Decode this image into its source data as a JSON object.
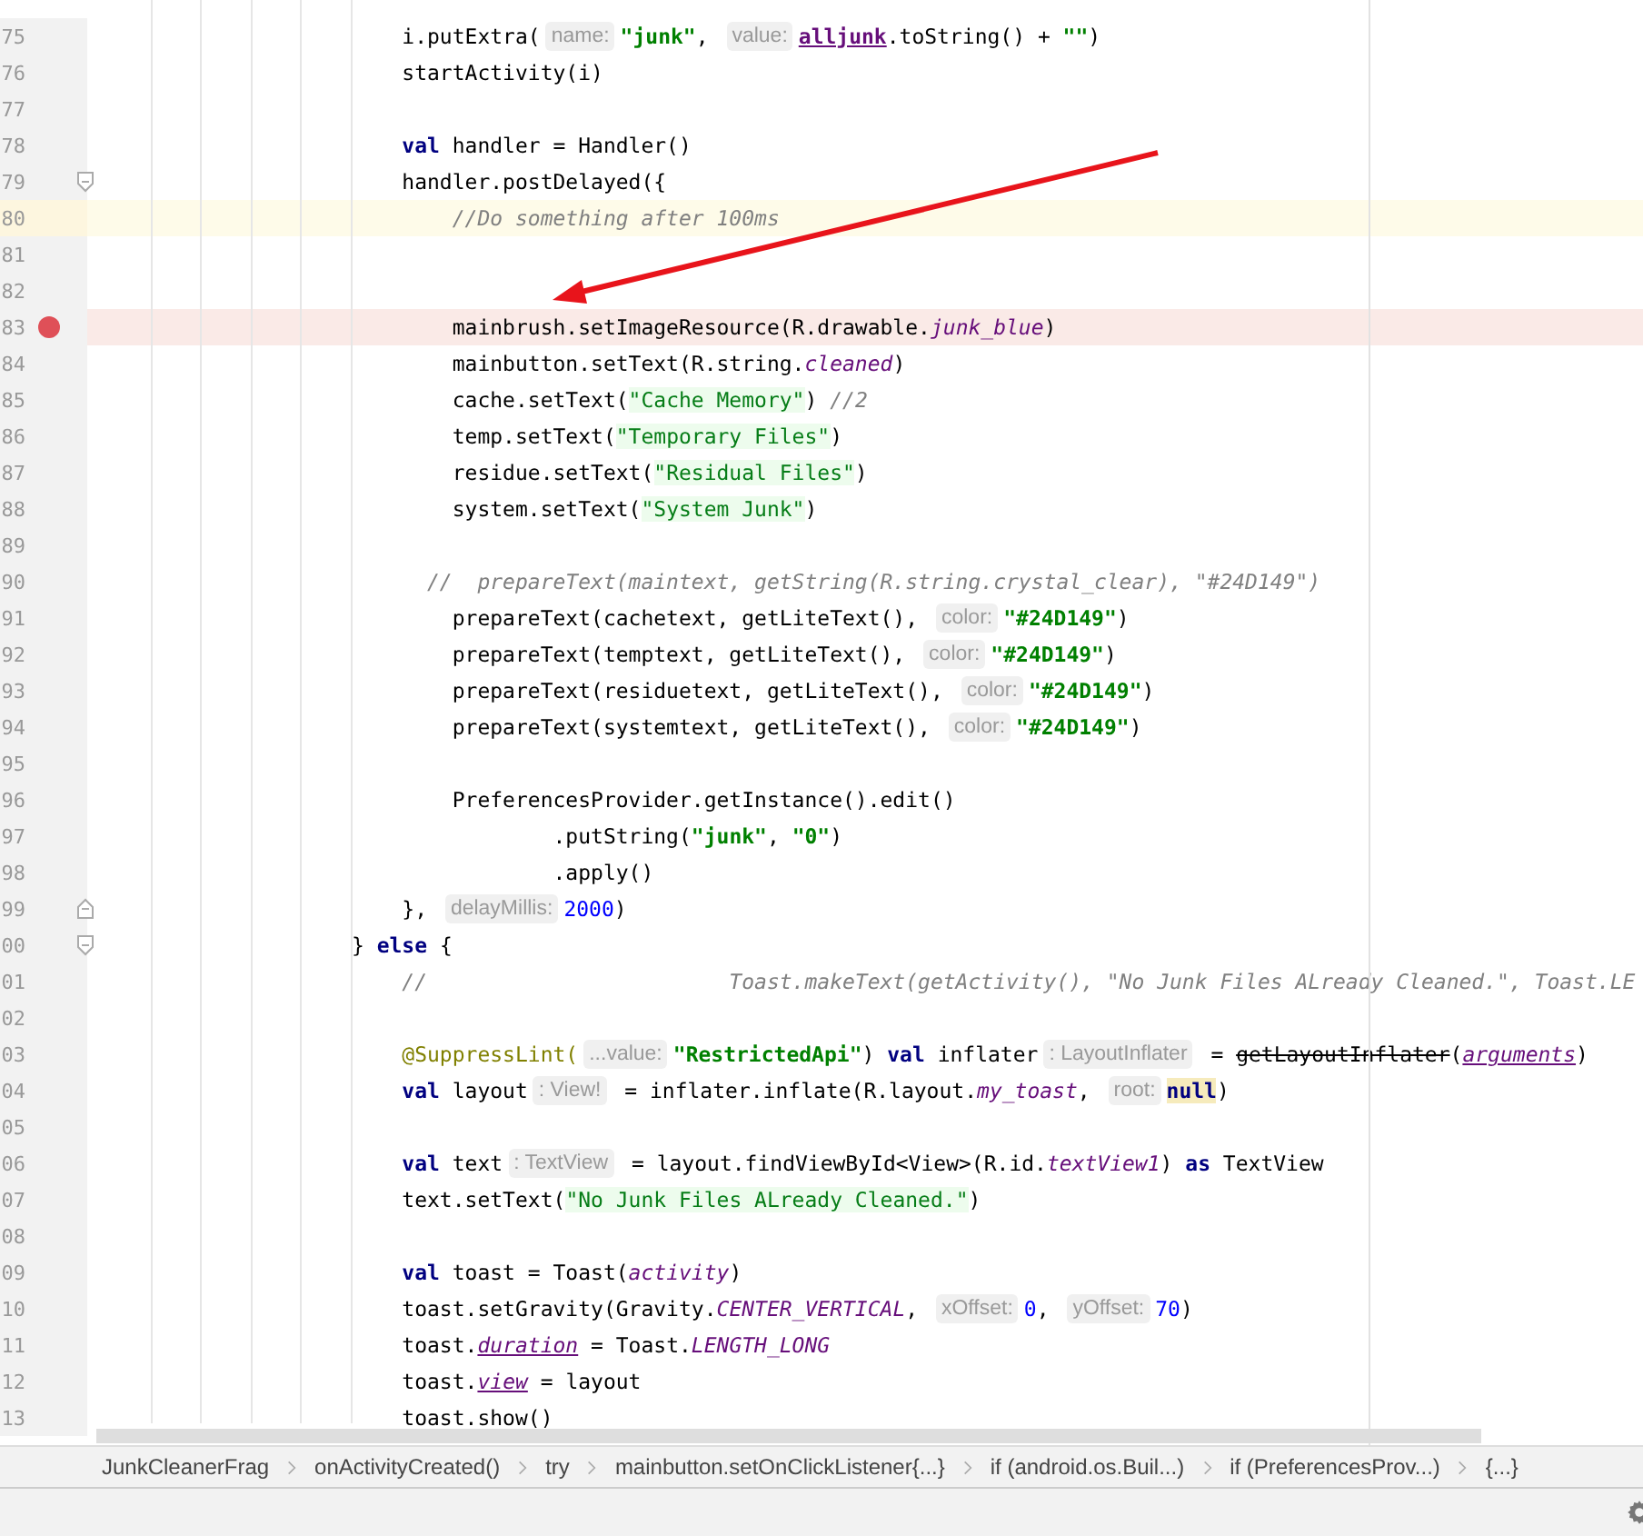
{
  "editor": {
    "lines": [
      {
        "number": "75",
        "breakpoint": false,
        "current": false,
        "tokens": [
          {
            "kind": "plain",
            "text": "                        i.putExtra("
          },
          {
            "kind": "hint",
            "text": "name:"
          },
          {
            "kind": "string",
            "text": "\"junk\""
          },
          {
            "kind": "plain",
            "text": ", "
          },
          {
            "kind": "hint",
            "text": "value:"
          },
          {
            "kind": "variable",
            "text": "alljunk"
          },
          {
            "kind": "plain",
            "text": ".toString() + "
          },
          {
            "kind": "string",
            "text": "\"\""
          },
          {
            "kind": "plain",
            "text": ")"
          }
        ]
      },
      {
        "number": "76",
        "breakpoint": false,
        "current": false,
        "tokens": [
          {
            "kind": "plain",
            "text": "                        startActivity(i)"
          }
        ]
      },
      {
        "number": "77",
        "breakpoint": false,
        "current": false
      },
      {
        "number": "78",
        "breakpoint": false,
        "current": false,
        "tokens": [
          {
            "kind": "keyword",
            "text": "                        val"
          },
          {
            "kind": "plain",
            "text": " handler = Handler()"
          }
        ]
      },
      {
        "number": "79",
        "breakpoint": false,
        "current": false,
        "fold_start": true,
        "tokens": [
          {
            "kind": "plain",
            "text": "                        handler.postDelayed({"
          }
        ]
      },
      {
        "number": "80",
        "breakpoint": false,
        "current": true,
        "tokens": [
          {
            "kind": "comment",
            "text": "                            //Do something after 100ms"
          }
        ]
      },
      {
        "number": "81",
        "breakpoint": false,
        "current": false
      },
      {
        "number": "82",
        "breakpoint": false,
        "current": false
      },
      {
        "number": "83",
        "breakpoint": true,
        "current": false,
        "tokens": [
          {
            "kind": "plain",
            "text": "                            mainbrush.setImageResource(R.drawable."
          },
          {
            "kind": "constant",
            "text": "junk_blue"
          },
          {
            "kind": "plain",
            "text": ")"
          }
        ]
      },
      {
        "number": "84",
        "breakpoint": false,
        "current": false,
        "tokens": [
          {
            "kind": "plain",
            "text": "                            mainbutton.setText(R.string."
          },
          {
            "kind": "constant",
            "text": "cleaned"
          },
          {
            "kind": "plain",
            "text": ")"
          }
        ]
      },
      {
        "number": "85",
        "breakpoint": false,
        "current": false,
        "tokens": [
          {
            "kind": "plain",
            "text": "                            cache.setText("
          },
          {
            "kind": "injected",
            "text": "\"Cache Memory\""
          },
          {
            "kind": "plain",
            "text": ") "
          },
          {
            "kind": "comment",
            "text": "//2"
          }
        ]
      },
      {
        "number": "86",
        "breakpoint": false,
        "current": false,
        "tokens": [
          {
            "kind": "plain",
            "text": "                            temp.setText("
          },
          {
            "kind": "injected",
            "text": "\"Temporary Files\""
          },
          {
            "kind": "plain",
            "text": ")"
          }
        ]
      },
      {
        "number": "87",
        "breakpoint": false,
        "current": false,
        "tokens": [
          {
            "kind": "plain",
            "text": "                            residue.setText("
          },
          {
            "kind": "injected",
            "text": "\"Residual Files\""
          },
          {
            "kind": "plain",
            "text": ")"
          }
        ]
      },
      {
        "number": "88",
        "breakpoint": false,
        "current": false,
        "tokens": [
          {
            "kind": "plain",
            "text": "                            system.setText("
          },
          {
            "kind": "injected",
            "text": "\"System Junk\""
          },
          {
            "kind": "plain",
            "text": ")"
          }
        ]
      },
      {
        "number": "89",
        "breakpoint": false,
        "current": false
      },
      {
        "number": "90",
        "breakpoint": false,
        "current": false,
        "tokens": [
          {
            "kind": "comment",
            "text": "                          //  prepareText(maintext, getString(R.string.crystal_clear), \"#24D149\")"
          }
        ]
      },
      {
        "number": "91",
        "breakpoint": false,
        "current": false,
        "tokens": [
          {
            "kind": "plain",
            "text": "                            prepareText(cachetext, getLiteText(), "
          },
          {
            "kind": "hint",
            "text": "color:"
          },
          {
            "kind": "string",
            "text": "\"#24D149\""
          },
          {
            "kind": "plain",
            "text": ")"
          }
        ]
      },
      {
        "number": "92",
        "breakpoint": false,
        "current": false,
        "tokens": [
          {
            "kind": "plain",
            "text": "                            prepareText(temptext, getLiteText(), "
          },
          {
            "kind": "hint",
            "text": "color:"
          },
          {
            "kind": "string",
            "text": "\"#24D149\""
          },
          {
            "kind": "plain",
            "text": ")"
          }
        ]
      },
      {
        "number": "93",
        "breakpoint": false,
        "current": false,
        "tokens": [
          {
            "kind": "plain",
            "text": "                            prepareText(residuetext, getLiteText(), "
          },
          {
            "kind": "hint",
            "text": "color:"
          },
          {
            "kind": "string",
            "text": "\"#24D149\""
          },
          {
            "kind": "plain",
            "text": ")"
          }
        ]
      },
      {
        "number": "94",
        "breakpoint": false,
        "current": false,
        "tokens": [
          {
            "kind": "plain",
            "text": "                            prepareText(systemtext, getLiteText(), "
          },
          {
            "kind": "hint",
            "text": "color:"
          },
          {
            "kind": "string",
            "text": "\"#24D149\""
          },
          {
            "kind": "plain",
            "text": ")"
          }
        ]
      },
      {
        "number": "95",
        "breakpoint": false,
        "current": false
      },
      {
        "number": "96",
        "breakpoint": false,
        "current": false,
        "tokens": [
          {
            "kind": "plain",
            "text": "                            PreferencesProvider.getInstance().edit()"
          }
        ]
      },
      {
        "number": "97",
        "breakpoint": false,
        "current": false,
        "tokens": [
          {
            "kind": "plain",
            "text": "                                    .putString("
          },
          {
            "kind": "string",
            "text": "\"junk\""
          },
          {
            "kind": "plain",
            "text": ", "
          },
          {
            "kind": "string",
            "text": "\"0\""
          },
          {
            "kind": "plain",
            "text": ")"
          }
        ]
      },
      {
        "number": "98",
        "breakpoint": false,
        "current": false,
        "tokens": [
          {
            "kind": "plain",
            "text": "                                    .apply()"
          }
        ]
      },
      {
        "number": "99",
        "breakpoint": false,
        "current": false,
        "fold_end": true,
        "tokens": [
          {
            "kind": "plain",
            "text": "                        }, "
          },
          {
            "kind": "hint",
            "text": "delayMillis:"
          },
          {
            "kind": "number",
            "text": "2000"
          },
          {
            "kind": "plain",
            "text": ")"
          }
        ]
      },
      {
        "number": "00",
        "breakpoint": false,
        "current": false,
        "fold_start": true,
        "tokens": [
          {
            "kind": "plain",
            "text": "                    } "
          },
          {
            "kind": "keyword",
            "text": "else"
          },
          {
            "kind": "plain",
            "text": " {"
          }
        ]
      },
      {
        "number": "01",
        "breakpoint": false,
        "current": false,
        "tokens": [
          {
            "kind": "comment",
            "text": "                        //                        Toast.makeText(getActivity(), \"No Junk Files ALready Cleaned.\", Toast.LE"
          }
        ]
      },
      {
        "number": "02",
        "breakpoint": false,
        "current": false
      },
      {
        "number": "03",
        "breakpoint": false,
        "current": false,
        "tokens": [
          {
            "kind": "annotation",
            "text": "                        @SuppressLint("
          },
          {
            "kind": "hint",
            "text": "...value:"
          },
          {
            "kind": "string",
            "text": "\"RestrictedApi\""
          },
          {
            "kind": "plain",
            "text": ") "
          },
          {
            "kind": "keyword",
            "text": "val"
          },
          {
            "kind": "plain",
            "text": " inflater"
          },
          {
            "kind": "hint",
            "text": ": LayoutInflater"
          },
          {
            "kind": "plain",
            "text": " = "
          },
          {
            "kind": "deprecated",
            "text": "getLayoutInflater"
          },
          {
            "kind": "plain",
            "text": "("
          },
          {
            "kind": "property",
            "text": "arguments"
          },
          {
            "kind": "plain",
            "text": ")"
          }
        ]
      },
      {
        "number": "04",
        "breakpoint": false,
        "current": false,
        "tokens": [
          {
            "kind": "keyword",
            "text": "                        val"
          },
          {
            "kind": "plain",
            "text": " layout"
          },
          {
            "kind": "hint",
            "text": ": View!"
          },
          {
            "kind": "plain",
            "text": " = inflater.inflate(R.layout."
          },
          {
            "kind": "constant",
            "text": "my_toast"
          },
          {
            "kind": "plain",
            "text": ", "
          },
          {
            "kind": "hint",
            "text": "root:"
          },
          {
            "kind": "null",
            "text": "null"
          },
          {
            "kind": "plain",
            "text": ")"
          }
        ]
      },
      {
        "number": "05",
        "breakpoint": false,
        "current": false
      },
      {
        "number": "06",
        "breakpoint": false,
        "current": false,
        "tokens": [
          {
            "kind": "keyword",
            "text": "                        val"
          },
          {
            "kind": "plain",
            "text": " text"
          },
          {
            "kind": "hint",
            "text": ": TextView"
          },
          {
            "kind": "plain",
            "text": " = layout.findViewById<View>(R.id."
          },
          {
            "kind": "constant",
            "text": "textView1"
          },
          {
            "kind": "plain",
            "text": ") "
          },
          {
            "kind": "keyword",
            "text": "as"
          },
          {
            "kind": "plain",
            "text": " TextView"
          }
        ]
      },
      {
        "number": "07",
        "breakpoint": false,
        "current": false,
        "tokens": [
          {
            "kind": "plain",
            "text": "                        text.setText("
          },
          {
            "kind": "injected",
            "text": "\"No Junk Files ALready Cleaned.\""
          },
          {
            "kind": "plain",
            "text": ")"
          }
        ]
      },
      {
        "number": "08",
        "breakpoint": false,
        "current": false
      },
      {
        "number": "09",
        "breakpoint": false,
        "current": false,
        "tokens": [
          {
            "kind": "keyword",
            "text": "                        val"
          },
          {
            "kind": "plain",
            "text": " toast = Toast("
          },
          {
            "kind": "constant",
            "text": "activity"
          },
          {
            "kind": "plain",
            "text": ")"
          }
        ]
      },
      {
        "number": "10",
        "breakpoint": false,
        "current": false,
        "tokens": [
          {
            "kind": "plain",
            "text": "                        toast.setGravity(Gravity."
          },
          {
            "kind": "constant",
            "text": "CENTER_VERTICAL"
          },
          {
            "kind": "plain",
            "text": ", "
          },
          {
            "kind": "hint",
            "text": "xOffset:"
          },
          {
            "kind": "number",
            "text": "0"
          },
          {
            "kind": "plain",
            "text": ", "
          },
          {
            "kind": "hint",
            "text": "yOffset:"
          },
          {
            "kind": "number",
            "text": "70"
          },
          {
            "kind": "plain",
            "text": ")"
          }
        ]
      },
      {
        "number": "11",
        "breakpoint": false,
        "current": false,
        "tokens": [
          {
            "kind": "plain",
            "text": "                        toast."
          },
          {
            "kind": "property",
            "text": "duration"
          },
          {
            "kind": "plain",
            "text": " = Toast."
          },
          {
            "kind": "constant",
            "text": "LENGTH_LONG"
          }
        ]
      },
      {
        "number": "12",
        "breakpoint": false,
        "current": false,
        "tokens": [
          {
            "kind": "plain",
            "text": "                        toast."
          },
          {
            "kind": "property",
            "text": "view"
          },
          {
            "kind": "plain",
            "text": " = layout"
          }
        ]
      },
      {
        "number": "13",
        "breakpoint": false,
        "current": false,
        "tokens": [
          {
            "kind": "plain",
            "text": "                        toast.show()"
          }
        ]
      }
    ]
  },
  "breadcrumbs": [
    "JunkCleanerFrag",
    "onActivityCreated()",
    "try",
    "mainbutton.setOnClickListener{...}",
    "if (android.os.Buil...)",
    "if (PreferencesProv...)",
    "{...}"
  ]
}
